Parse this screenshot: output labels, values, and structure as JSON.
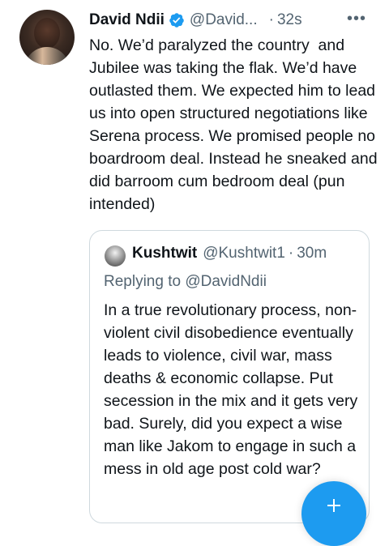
{
  "tweet": {
    "author_name": "David Ndii",
    "author_handle": "@David...",
    "separator": "·",
    "time": "32s",
    "more_label": "•••",
    "text": "No. We’d paralyzed the country  and Jubilee was taking the flak. We’d have outlasted them. We expected him to lead us into open structured negotiations like Serena process. We promised people no boardroom deal. Instead he sneaked and did barroom cum bedroom deal (pun intended)"
  },
  "quoted_tweet": {
    "author_name": "Kushtwit",
    "author_handle": "@Kushtwit1",
    "separator": "·",
    "time": "30m",
    "replying_to_prefix": "Replying to ",
    "replying_to_handle": "@DavidNdii",
    "text": "In a true revolutionary process, non-violent civil disobedience eventually leads to violence, civil war, mass deaths & economic collapse. Put secession in the mix and it gets very bad. Surely, did you expect a wise man like Jakom to engage in such a mess in old age post cold war?"
  },
  "icons": {
    "verified": "verified-badge-icon",
    "more": "more-options-icon",
    "compose": "compose-tweet-icon"
  },
  "colors": {
    "accent": "#1d9bf0",
    "text_primary": "#0f1419",
    "text_secondary": "#536471",
    "border": "#cfd9de"
  }
}
